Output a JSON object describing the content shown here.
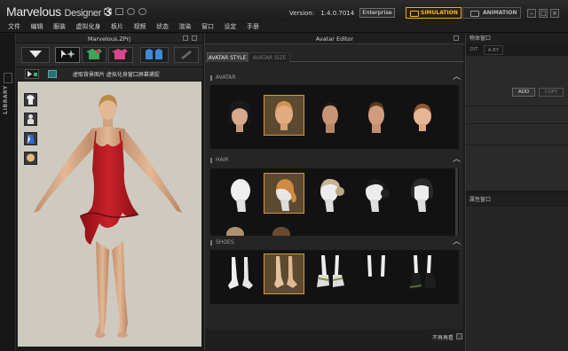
{
  "app": {
    "name": "Marvelous",
    "name_suffix": "Designer",
    "version_number": "3",
    "version_label": "Version:",
    "version": "1.4.0.7014",
    "edition": "Enterprise"
  },
  "mode_buttons": {
    "simulation": "SIMULATION",
    "animation": "ANIMATION"
  },
  "window_controls": {
    "minimize": "–",
    "maximize": "□",
    "close": "×"
  },
  "menu": [
    "文件",
    "编辑",
    "服装",
    "虚拟化身",
    "板片",
    "视频",
    "状态",
    "渲染",
    "窗口",
    "设定",
    "手册"
  ],
  "library": {
    "label": "LIBRARY"
  },
  "viewport": {
    "title": "Marvelous.ZPrj",
    "sub_buttons": "虚取背景图片 虚拟化身窗口屏幕捕捉"
  },
  "editor": {
    "title": "Avatar Editor",
    "tabs": [
      "AVATAR STYLE",
      "AVATAR SIZE"
    ],
    "sections": {
      "avatar": "AVATAR",
      "hair": "HAIR",
      "shoes": "SHOES"
    },
    "footer_label": "不再再看"
  },
  "right_panel": {
    "head": "物体窗口",
    "tabs": [
      "DIT",
      "A-EY"
    ],
    "add": "ADD",
    "copy": "COPY",
    "head2": "属性窗口"
  },
  "colors": {
    "accent": "#f2a81d",
    "selection": "#d39a3e",
    "dress": "#b4191f"
  }
}
